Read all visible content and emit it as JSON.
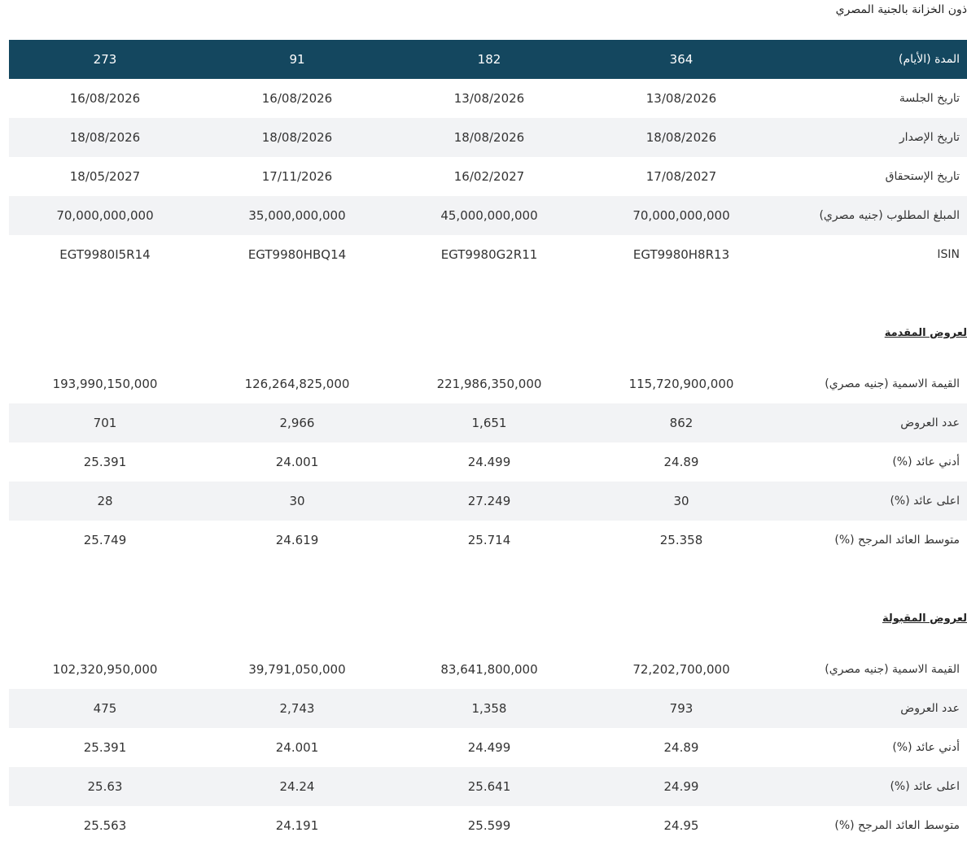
{
  "page": {
    "title": "ذون الخزانة بالجنية المصري"
  },
  "terms_table": {
    "header": {
      "label": "المدة (الأيام)",
      "values": [
        "273",
        "91",
        "182",
        "364"
      ]
    },
    "rows": [
      {
        "label": "تاريخ الجلسة",
        "values": [
          "16/08/2026",
          "16/08/2026",
          "13/08/2026",
          "13/08/2026"
        ]
      },
      {
        "label": "تاريخ الإصدار",
        "values": [
          "18/08/2026",
          "18/08/2026",
          "18/08/2026",
          "18/08/2026"
        ]
      },
      {
        "label": "تاريخ الإستحقاق",
        "values": [
          "18/05/2027",
          "17/11/2026",
          "16/02/2027",
          "17/08/2027"
        ]
      },
      {
        "label": "المبلغ المطلوب (جنيه مصري)",
        "values": [
          "70,000,000,000",
          "35,000,000,000",
          "45,000,000,000",
          "70,000,000,000"
        ]
      },
      {
        "label": "ISIN",
        "values": [
          "EGT9980I5R14",
          "EGT9980HBQ14",
          "EGT9980G2R11",
          "EGT9980H8R13"
        ]
      }
    ]
  },
  "offered_section": {
    "heading": "لعروض المقدمة",
    "rows": [
      {
        "label": "القيمة الاسمية (جنيه مصري)",
        "values": [
          "193,990,150,000",
          "126,264,825,000",
          "221,986,350,000",
          "115,720,900,000"
        ]
      },
      {
        "label": "عدد العروض",
        "values": [
          "701",
          "2,966",
          "1,651",
          "862"
        ]
      },
      {
        "label": "أدني عائد (%)",
        "values": [
          "25.391",
          "24.001",
          "24.499",
          "24.89"
        ]
      },
      {
        "label": "اعلى عائد (%)",
        "values": [
          "28",
          "30",
          "27.249",
          "30"
        ]
      },
      {
        "label": "متوسط العائد المرجح (%)",
        "values": [
          "25.749",
          "24.619",
          "25.714",
          "25.358"
        ]
      }
    ]
  },
  "accepted_section": {
    "heading": "لعروض المقبولة",
    "rows": [
      {
        "label": "القيمة الاسمية (جنيه مصري)",
        "values": [
          "102,320,950,000",
          "39,791,050,000",
          "83,641,800,000",
          "72,202,700,000"
        ]
      },
      {
        "label": "عدد العروض",
        "values": [
          "475",
          "2,743",
          "1,358",
          "793"
        ]
      },
      {
        "label": "أدني عائد (%)",
        "values": [
          "25.391",
          "24.001",
          "24.499",
          "24.89"
        ]
      },
      {
        "label": "اعلى عائد (%)",
        "values": [
          "25.63",
          "24.24",
          "25.641",
          "24.99"
        ]
      },
      {
        "label": "متوسط العائد المرجح (%)",
        "values": [
          "25.563",
          "24.191",
          "25.599",
          "24.95"
        ]
      }
    ]
  },
  "colors": {
    "header_bg": "#14475f",
    "header_text": "#ffffff",
    "row_shade": "#f2f3f5",
    "body_text": "#333333"
  }
}
